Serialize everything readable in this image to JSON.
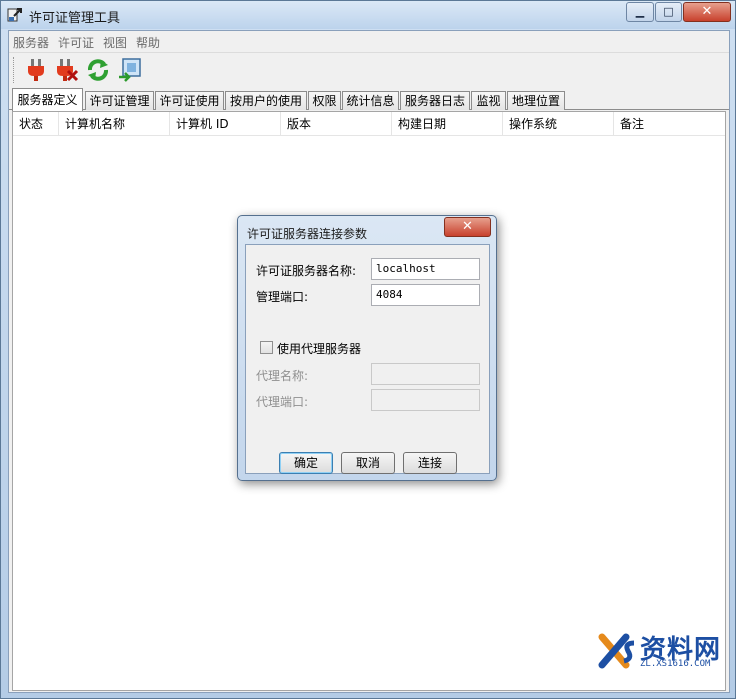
{
  "window": {
    "title": "许可证管理工具",
    "controls": {
      "minimize": "▁",
      "maximize": "□",
      "close": "✕"
    }
  },
  "menu": [
    "服务器",
    "许可证",
    "视图",
    "帮助"
  ],
  "toolbar": {
    "buttons": [
      "plug-connect-icon",
      "plug-disconnect-icon",
      "refresh-icon",
      "export-icon"
    ]
  },
  "tabs": [
    "服务器定义",
    "许可证管理",
    "许可证使用",
    "按用户的使用",
    "权限",
    "统计信息",
    "服务器日志",
    "监视",
    "地理位置"
  ],
  "active_tab": "服务器定义",
  "list": {
    "columns": [
      "状态",
      "计算机名称",
      "计算机 ID",
      "版本",
      "构建日期",
      "操作系统",
      "备注"
    ]
  },
  "dialog": {
    "title": "许可证服务器连接参数",
    "close": "✕",
    "server_name_label": "许可证服务器名称:",
    "server_name_value": "localhost",
    "port_label": "管理端口:",
    "port_value": "4084",
    "proxy_checkbox_label": "使用代理服务器",
    "proxy_checked": false,
    "proxy_name_label": "代理名称:",
    "proxy_name_value": "",
    "proxy_port_label": "代理端口:",
    "proxy_port_value": "",
    "ok_label": "确定",
    "cancel_label": "取消",
    "connect_label": "连接"
  },
  "watermark": {
    "text": "资料网",
    "url": "ZL.XS1616.COM"
  },
  "colors": {
    "titlebar": "#c4d8ee",
    "close_button": "#c8412d",
    "watermark": "#1d4fa3"
  }
}
